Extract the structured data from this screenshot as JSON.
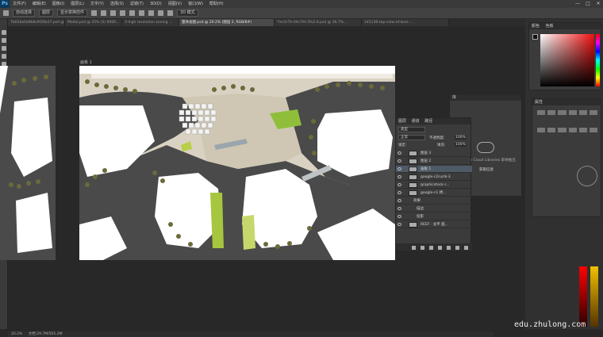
{
  "app": {
    "logo": "Ps",
    "menus": [
      "文件(F)",
      "编辑(E)",
      "图像(I)",
      "图层(L)",
      "文字(Y)",
      "选择(S)",
      "滤镜(T)",
      "3D(D)",
      "视图(V)",
      "窗口(W)",
      "帮助(H)"
    ],
    "window_controls": [
      "—",
      "□",
      "✕"
    ]
  },
  "options": {
    "auto_select": "自动选择",
    "layer_select": "图层",
    "transform": "显示变换控件",
    "mode_3d": "3D 模式"
  },
  "tabs": [
    "7b02ba0a9b8c6f26b37.psd @ 100%...",
    "Model.psd @ 25% (5) 6000...",
    "3-high resolution zoning ...",
    "量体总图.psd @ 20.2% (图层 2, RGB/8#)",
    "*Inc5rTh-04c7IH-3%2-6.psd @ 16.7%...",
    "145136-top-view-of-lane-..."
  ],
  "active_tab": 3,
  "document": {
    "artboard_label": "画板 1"
  },
  "panels": {
    "color_title": "颜色",
    "color_tab2": "色板",
    "layers_title": "图层",
    "layers_tab2": "通道",
    "layers_tab3": "路径",
    "kind": "类型",
    "blend": "正常",
    "opacity_label": "不透明度:",
    "opacity_value": "100%",
    "lock_label": "锁定:",
    "fill_label": "填充:",
    "fill_value": "100%",
    "libraries_title": "库",
    "libraries_text": "Creative Cloud Libraries 即将推出",
    "libraries_button": "获取信息",
    "properties_title": "属性"
  },
  "layers": [
    {
      "name": "图层 3",
      "selected": false
    },
    {
      "name": "图层 2",
      "selected": false
    },
    {
      "name": "画板 1",
      "selected": true
    },
    {
      "name": "google-c2ruclk-3",
      "selected": false
    },
    {
      "name": "graphicstock-r...",
      "selected": false
    },
    {
      "name": "google-c1 拷...",
      "selected": false
    },
    {
      "name": "效果",
      "selected": false
    },
    {
      "name": "描边",
      "selected": false
    },
    {
      "name": "投影",
      "selected": false
    },
    {
      "name": "REEF · 总平 面...",
      "selected": false
    }
  ],
  "watermark": "edu.zhulong.com",
  "status": {
    "zoom": "20.2%",
    "doc_info": "文档:29.7M/565.2M"
  }
}
